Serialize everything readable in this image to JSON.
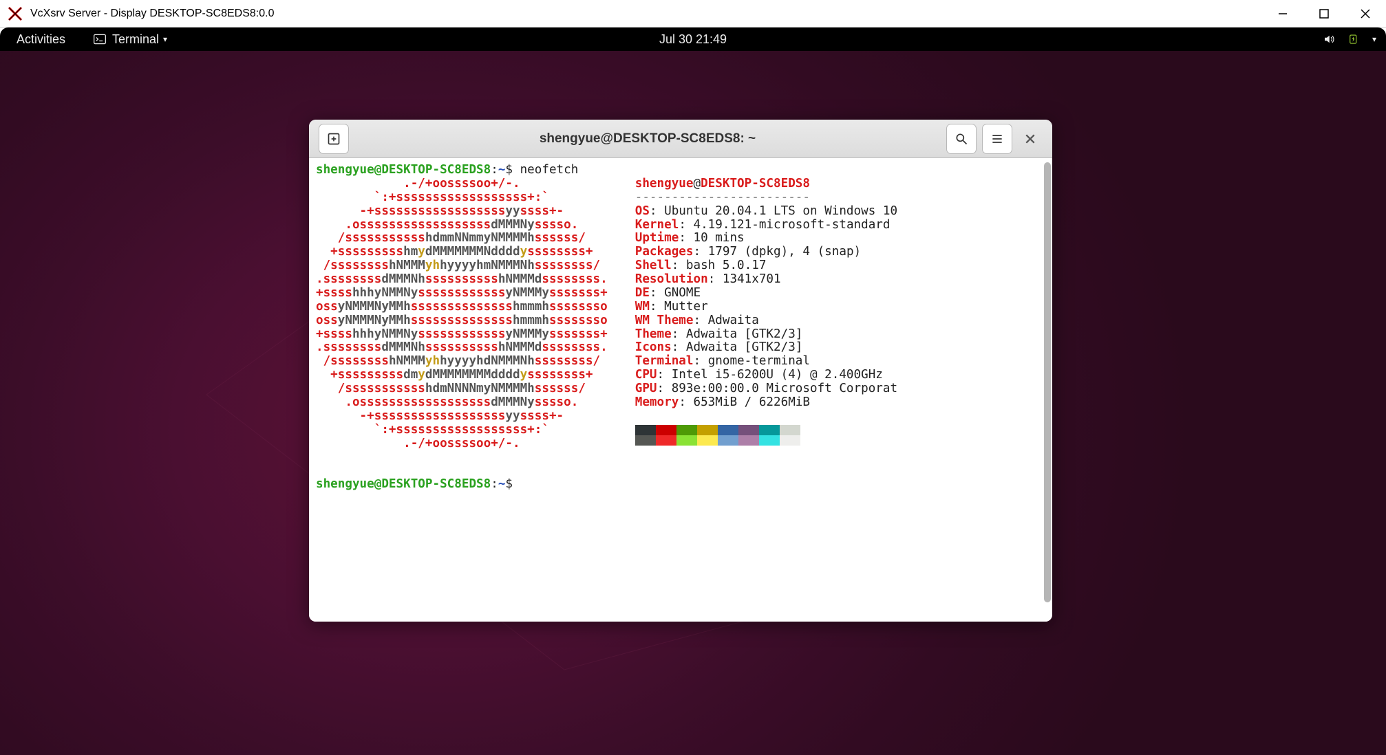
{
  "windows_title": "VcXsrv Server - Display DESKTOP-SC8EDS8:0.0",
  "gnome": {
    "activities": "Activities",
    "app_label": "Terminal",
    "clock": "Jul 30  21:49"
  },
  "terminal": {
    "title": "shengyue@DESKTOP-SC8EDS8: ~",
    "prompt_user": "shengyue@DESKTOP-SC8EDS8",
    "prompt_cwd": "~",
    "prompt_sep1": ":",
    "prompt_sep2": "$ ",
    "command": "neofetch",
    "userhost_line_user": "shengyue",
    "userhost_line_at": "@",
    "userhost_line_host": "DESKTOP-SC8EDS8",
    "dashes": "------------------------",
    "logo_lines": [
      [
        [
          "r",
          "            .-/+oossssoo+/-."
        ]
      ],
      [
        [
          "r",
          "        `:+ssssssssssssssssss+:`"
        ]
      ],
      [
        [
          "r",
          "      -+ssssssssssssssssss"
        ],
        [
          "g",
          "yy"
        ],
        [
          "r",
          "ssss+-"
        ]
      ],
      [
        [
          "r",
          "    .ossssssssssssssssss"
        ],
        [
          "g",
          "dMMMNy"
        ],
        [
          "r",
          "sssso."
        ]
      ],
      [
        [
          "r",
          "   /sssssssssss"
        ],
        [
          "g",
          "hdmmNNmmyNMMMMh"
        ],
        [
          "r",
          "ssssss/"
        ]
      ],
      [
        [
          "r",
          "  +sssssssss"
        ],
        [
          "g",
          "hm"
        ],
        [
          "y",
          "y"
        ],
        [
          "g",
          "dMMMMMMMNdddd"
        ],
        [
          "y",
          "y"
        ],
        [
          "r",
          "ssssssss+"
        ]
      ],
      [
        [
          "r",
          " /ssssssss"
        ],
        [
          "g",
          "hNMMM"
        ],
        [
          "y",
          "yh"
        ],
        [
          "g",
          "hyyyyhmNMMMNh"
        ],
        [
          "r",
          "ssssssss/"
        ]
      ],
      [
        [
          "r",
          ".ssssssss"
        ],
        [
          "g",
          "dMMMNh"
        ],
        [
          "r",
          "ssssssssss"
        ],
        [
          "g",
          "hNMMMd"
        ],
        [
          "r",
          "ssssssss."
        ]
      ],
      [
        [
          "r",
          "+ssss"
        ],
        [
          "g",
          "hhhyNMMNy"
        ],
        [
          "r",
          "ssssssssssss"
        ],
        [
          "g",
          "yNMMMy"
        ],
        [
          "r",
          "sssssss+"
        ]
      ],
      [
        [
          "r",
          "oss"
        ],
        [
          "g",
          "yNMMMNyMMh"
        ],
        [
          "r",
          "ssssssssssssss"
        ],
        [
          "g",
          "hmmmh"
        ],
        [
          "r",
          "ssssssso"
        ]
      ],
      [
        [
          "r",
          "oss"
        ],
        [
          "g",
          "yNMMMNyMMh"
        ],
        [
          "r",
          "ssssssssssssss"
        ],
        [
          "g",
          "hmmmh"
        ],
        [
          "r",
          "ssssssso"
        ]
      ],
      [
        [
          "r",
          "+ssss"
        ],
        [
          "g",
          "hhhyNMMNy"
        ],
        [
          "r",
          "ssssssssssss"
        ],
        [
          "g",
          "yNMMMy"
        ],
        [
          "r",
          "sssssss+"
        ]
      ],
      [
        [
          "r",
          ".ssssssss"
        ],
        [
          "g",
          "dMMMNh"
        ],
        [
          "r",
          "ssssssssss"
        ],
        [
          "g",
          "hNMMMd"
        ],
        [
          "r",
          "ssssssss."
        ]
      ],
      [
        [
          "r",
          " /ssssssss"
        ],
        [
          "g",
          "hNMMM"
        ],
        [
          "y",
          "yh"
        ],
        [
          "g",
          "hyyyyhdNMMMNh"
        ],
        [
          "r",
          "ssssssss/"
        ]
      ],
      [
        [
          "r",
          "  +sssssssss"
        ],
        [
          "g",
          "dm"
        ],
        [
          "y",
          "y"
        ],
        [
          "g",
          "dMMMMMMMMdddd"
        ],
        [
          "y",
          "y"
        ],
        [
          "r",
          "ssssssss+"
        ]
      ],
      [
        [
          "r",
          "   /sssssssssss"
        ],
        [
          "g",
          "hdmNNNNmyNMMMMh"
        ],
        [
          "r",
          "ssssss/"
        ]
      ],
      [
        [
          "r",
          "    .ossssssssssssssssss"
        ],
        [
          "g",
          "dMMMNy"
        ],
        [
          "r",
          "sssso."
        ]
      ],
      [
        [
          "r",
          "      -+ssssssssssssssssss"
        ],
        [
          "g",
          "yy"
        ],
        [
          "r",
          "ssss+-"
        ]
      ],
      [
        [
          "r",
          "        `:+ssssssssssssssssss+:`"
        ]
      ],
      [
        [
          "r",
          "            .-/+oossssoo+/-."
        ]
      ]
    ],
    "info": [
      {
        "k": "OS",
        "v": "Ubuntu 20.04.1 LTS on Windows 10"
      },
      {
        "k": "Kernel",
        "v": "4.19.121-microsoft-standard"
      },
      {
        "k": "Uptime",
        "v": "10 mins"
      },
      {
        "k": "Packages",
        "v": "1797 (dpkg), 4 (snap)"
      },
      {
        "k": "Shell",
        "v": "bash 5.0.17"
      },
      {
        "k": "Resolution",
        "v": "1341x701"
      },
      {
        "k": "DE",
        "v": "GNOME"
      },
      {
        "k": "WM",
        "v": "Mutter"
      },
      {
        "k": "WM Theme",
        "v": "Adwaita"
      },
      {
        "k": "Theme",
        "v": "Adwaita [GTK2/3]"
      },
      {
        "k": "Icons",
        "v": "Adwaita [GTK2/3]"
      },
      {
        "k": "Terminal",
        "v": "gnome-terminal"
      },
      {
        "k": "CPU",
        "v": "Intel i5-6200U (4) @ 2.400GHz"
      },
      {
        "k": "GPU",
        "v": "893e:00:00.0 Microsoft Corporat"
      },
      {
        "k": "Memory",
        "v": "653MiB / 6226MiB"
      }
    ]
  }
}
